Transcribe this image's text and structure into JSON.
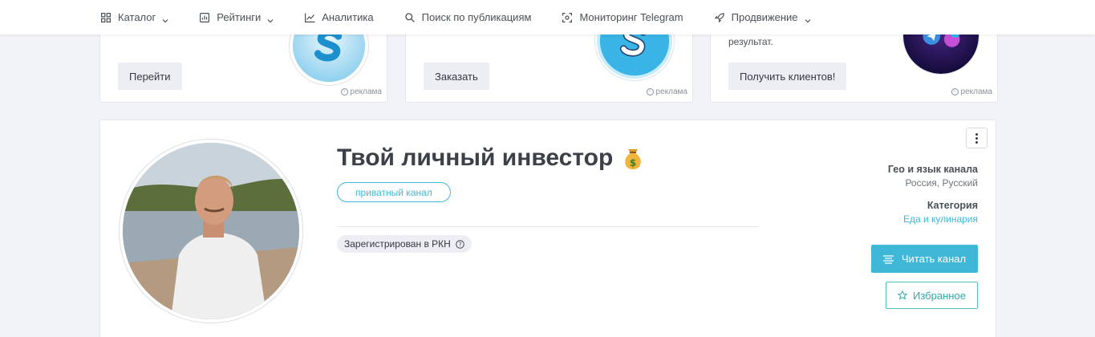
{
  "nav": {
    "items": [
      {
        "label": "Каталог",
        "icon": "grid-icon",
        "dropdown": true
      },
      {
        "label": "Рейтинги",
        "icon": "chart-box-icon",
        "dropdown": true
      },
      {
        "label": "Аналитика",
        "icon": "line-chart-icon",
        "dropdown": false
      },
      {
        "label": "Поиск по публикациям",
        "icon": "search-icon",
        "dropdown": false
      },
      {
        "label": "Мониторинг Telegram",
        "icon": "scan-icon",
        "dropdown": false
      },
      {
        "label": "Продвижение",
        "icon": "rocket-icon",
        "dropdown": true
      }
    ]
  },
  "ads": [
    {
      "button": "Перейти",
      "text": "",
      "ad_label": "реклама"
    },
    {
      "button": "Заказать",
      "text": "",
      "ad_label": "реклама"
    },
    {
      "button": "Получить клиентов!",
      "text": "результат.",
      "ad_label": "реклама"
    }
  ],
  "channel": {
    "title": "Твой личный инвестор",
    "title_emoji": "money-bag-icon",
    "type_badge": "приватный канал",
    "rkn_badge": "Зарегистрирован в РКН",
    "geo_label": "Гео и язык канала",
    "geo_value": "Россия, Русский",
    "category_label": "Категория",
    "category_value": "Еда и кулинария",
    "read_button": "Читать канал",
    "fav_button": "Избранное"
  },
  "colors": {
    "accent": "#3fb8d8",
    "teal": "#2ea9a9"
  }
}
